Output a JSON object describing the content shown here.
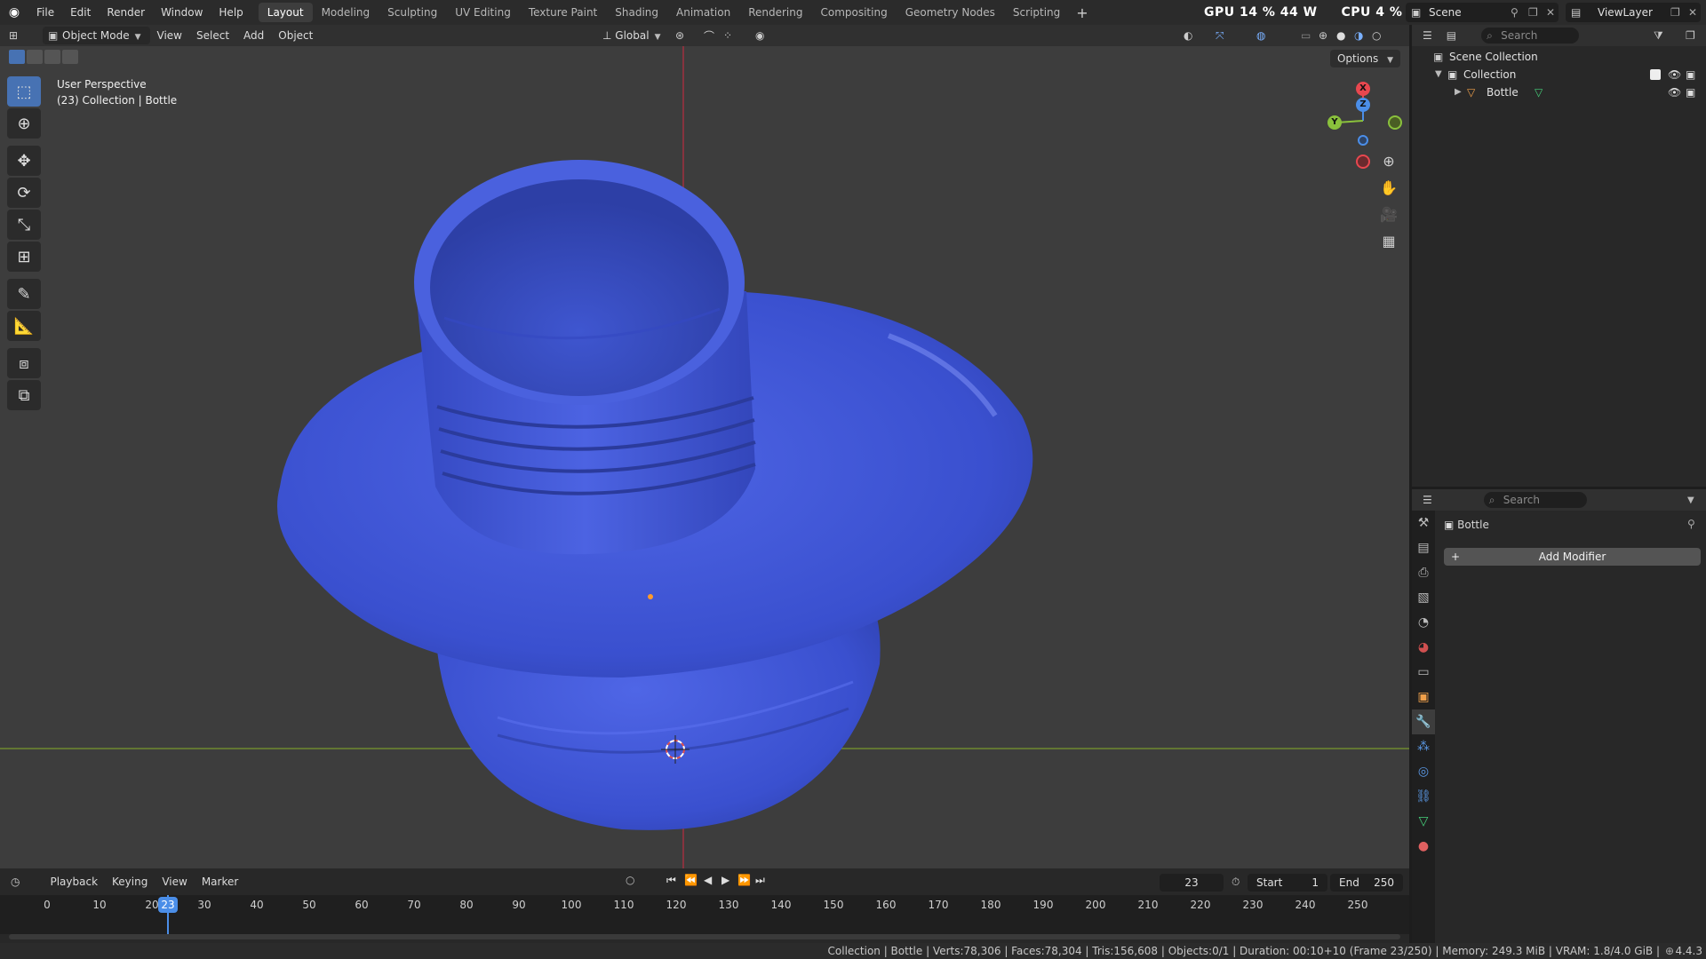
{
  "menu": {
    "file": "File",
    "edit": "Edit",
    "render": "Render",
    "window": "Window",
    "help": "Help"
  },
  "workspaces": [
    "Layout",
    "Modeling",
    "Sculpting",
    "UV Editing",
    "Texture Paint",
    "Shading",
    "Animation",
    "Rendering",
    "Compositing",
    "Geometry Nodes",
    "Scripting"
  ],
  "active_workspace": "Layout",
  "stats": {
    "gpu": "GPU  14 %  44 W",
    "cpu": "CPU  4 %"
  },
  "scene": {
    "name": "Scene"
  },
  "view_layer": {
    "name": "ViewLayer"
  },
  "viewport": {
    "mode": "Object Mode",
    "menus": {
      "view": "View",
      "select": "Select",
      "add": "Add",
      "object": "Object"
    },
    "transform_orientation": "Global",
    "options": "Options",
    "info_line1": "User Perspective",
    "info_line2": "(23) Collection | Bottle",
    "gizmo": {
      "x": "X",
      "y": "Y",
      "z": "Z"
    }
  },
  "outliner": {
    "search_placeholder": "Search",
    "scene_collection": "Scene Collection",
    "collection": "Collection",
    "object": "Bottle"
  },
  "properties": {
    "search_placeholder": "Search",
    "object_name": "Bottle",
    "add_modifier": "Add Modifier"
  },
  "timeline": {
    "menus": {
      "playback": "Playback",
      "keying": "Keying",
      "view": "View",
      "marker": "Marker"
    },
    "current_frame": "23",
    "start_label": "Start",
    "start": "1",
    "end_label": "End",
    "end": "250",
    "ticks": [
      "0",
      "10",
      "20",
      "30",
      "40",
      "50",
      "60",
      "70",
      "80",
      "90",
      "100",
      "110",
      "120",
      "130",
      "140",
      "150",
      "160",
      "170",
      "180",
      "190",
      "200",
      "210",
      "220",
      "230",
      "240",
      "250"
    ]
  },
  "statusbar": {
    "text": "Collection | Bottle | Verts:78,306 | Faces:78,304 | Tris:156,608 | Objects:0/1 | Duration: 00:10+10 (Frame 23/250) | Memory: 249.3 MiB | VRAM: 1.8/4.0 GiB |",
    "version": "4.4.3"
  },
  "colors": {
    "accent": "#4772b3",
    "bottle": "#3f57d6",
    "x_axis": "#e8474f",
    "y_axis": "#8ac13c",
    "z_axis": "#4b8ee8"
  }
}
